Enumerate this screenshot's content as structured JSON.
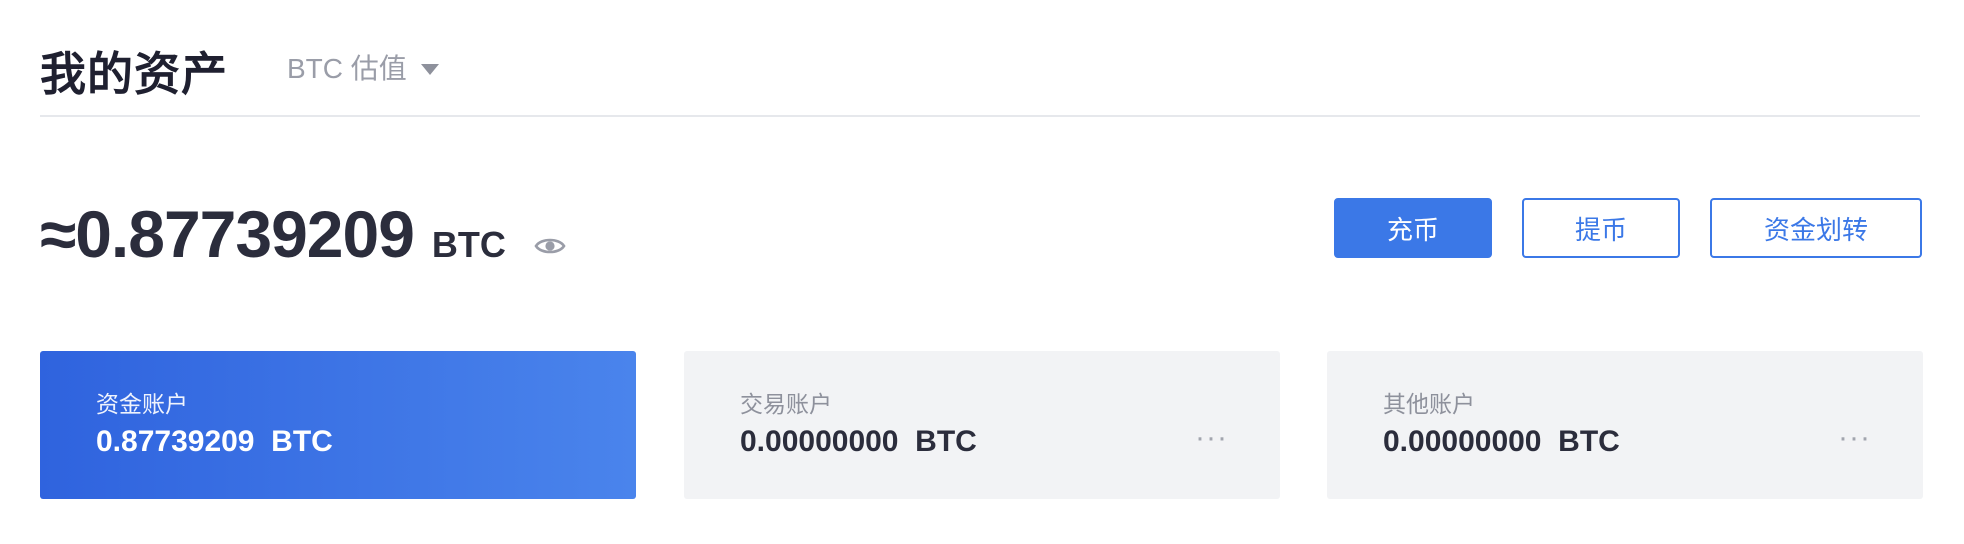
{
  "header": {
    "title": "我的资产",
    "valuation_label": "BTC 估值"
  },
  "summary": {
    "total_amount": "≈0.87739209",
    "total_unit": "BTC"
  },
  "actions": {
    "deposit_label": "充币",
    "withdraw_label": "提币",
    "transfer_label": "资金划转"
  },
  "accounts": [
    {
      "label": "资金账户",
      "amount": "0.87739209",
      "unit": "BTC"
    },
    {
      "label": "交易账户",
      "amount": "0.00000000",
      "unit": "BTC",
      "more": "···"
    },
    {
      "label": "其他账户",
      "amount": "0.00000000",
      "unit": "BTC",
      "more": "···"
    }
  ],
  "colors": {
    "accent": "#3b78e7",
    "card_gradient_start": "#2f63de",
    "card_gradient_end": "#4a84ec",
    "card_bg": "#f2f3f5"
  },
  "icons": {
    "visibility": "eye-icon",
    "dropdown": "caret-down-icon",
    "more": "more-icon"
  }
}
